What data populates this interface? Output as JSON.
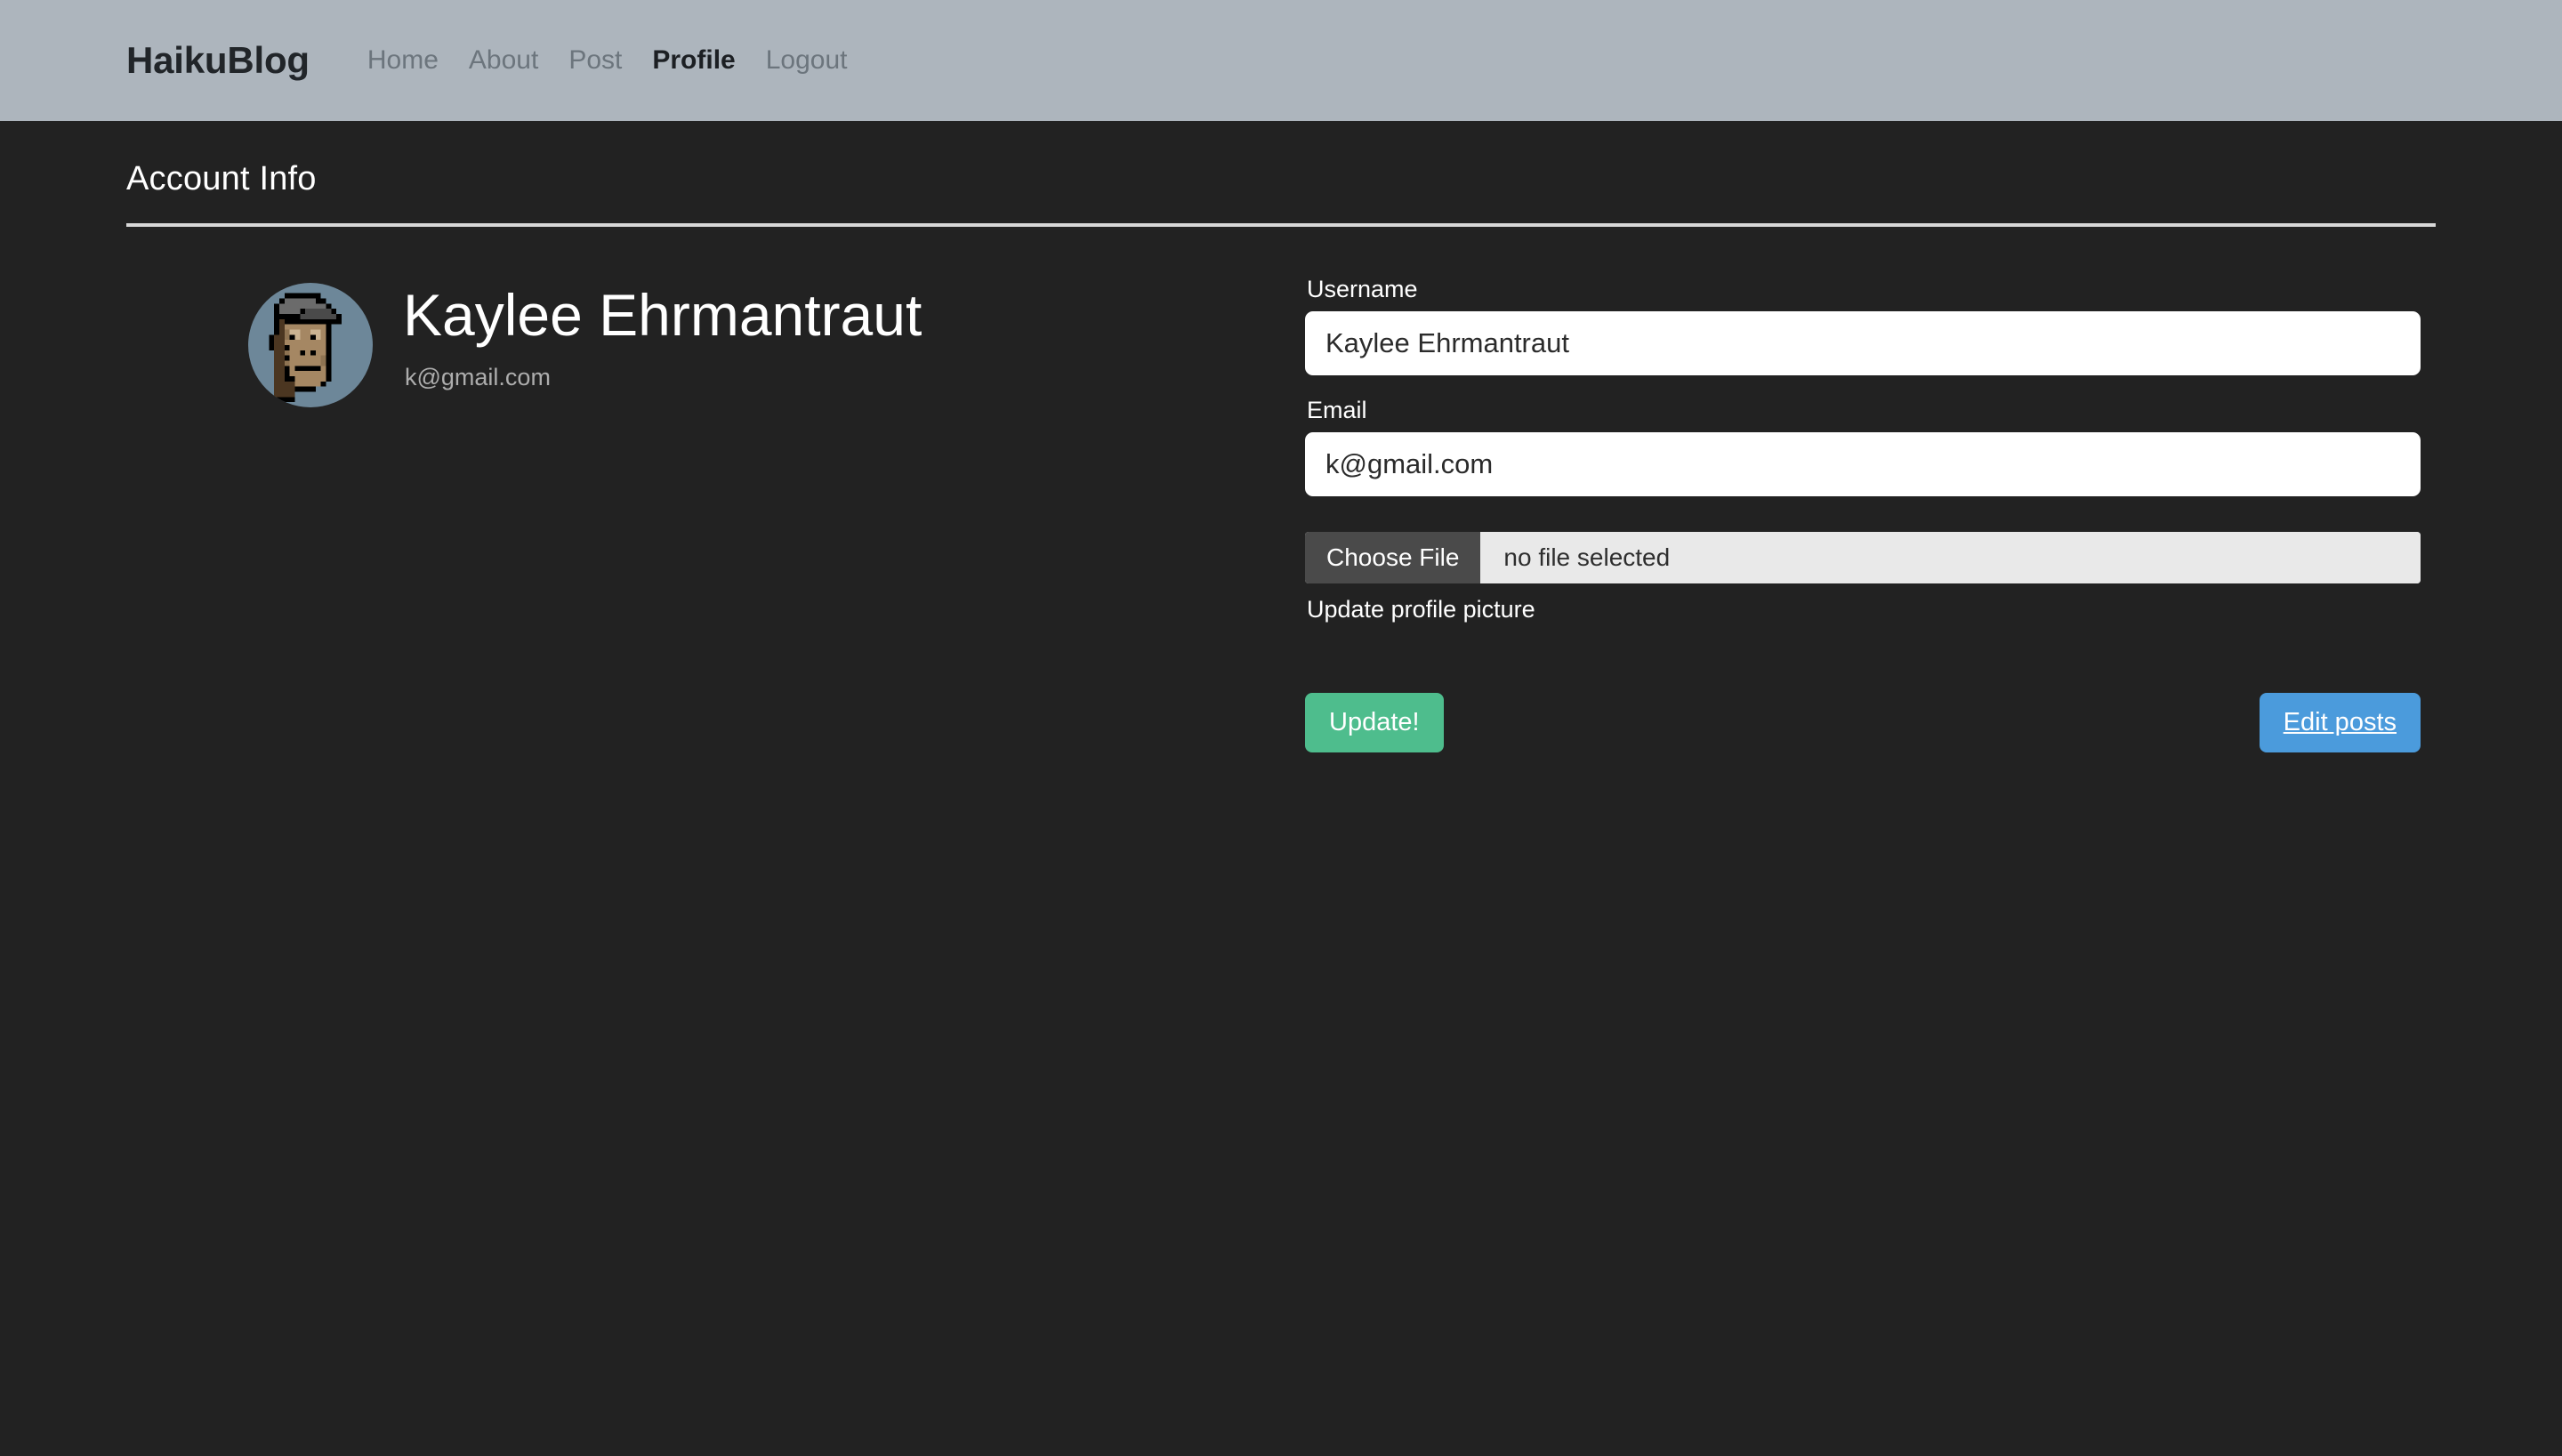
{
  "navbar": {
    "brand": "HaikuBlog",
    "links": [
      {
        "label": "Home",
        "active": false
      },
      {
        "label": "About",
        "active": false
      },
      {
        "label": "Post",
        "active": false
      },
      {
        "label": "Profile",
        "active": true
      },
      {
        "label": "Logout",
        "active": false
      }
    ],
    "background_color": "#adb5bd",
    "link_color": "#6c757d",
    "active_link_color": "#212529"
  },
  "page": {
    "heading": "Account Info",
    "background_color": "#222222",
    "text_color": "#ffffff"
  },
  "profile": {
    "avatar_icon": "pixel-punk-avatar",
    "avatar_background_color": "#6d8799",
    "display_name": "Kaylee Ehrmantraut",
    "email": "k@gmail.com"
  },
  "form": {
    "username": {
      "label": "Username",
      "value": "Kaylee Ehrmantraut",
      "placeholder": "Username"
    },
    "email": {
      "label": "Email",
      "value": "k@gmail.com",
      "placeholder": "Email"
    },
    "file": {
      "button_label": "Choose File",
      "status_text": "no file selected",
      "help_text": "Update profile picture"
    },
    "buttons": {
      "update": {
        "label": "Update!",
        "color": "#4ebd8d"
      },
      "edit_posts": {
        "label": "Edit posts",
        "color": "#4b9bdc"
      }
    }
  }
}
